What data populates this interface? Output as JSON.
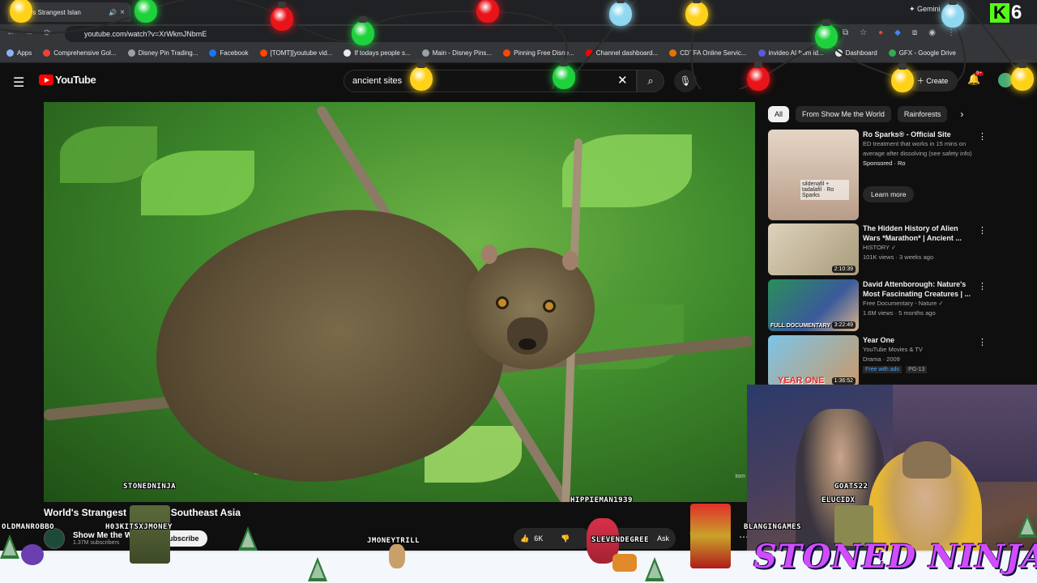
{
  "browser": {
    "tab_title": "World's Strangest Islan",
    "tab_close": "×",
    "gemini_label": "✦ Gemini",
    "url": "youtube.com/watch?v=XrWkmJNbmE",
    "nav_icons": [
      "←",
      "→",
      "⟳"
    ],
    "kick_badge": "K",
    "window_number": "6"
  },
  "bookmarks": [
    {
      "label": "Apps",
      "color": "#8ab4f8"
    },
    {
      "label": "Comprehensive Gol...",
      "color": "#ea4335"
    },
    {
      "label": "Disney Pin Trading...",
      "color": "#9aa0a6"
    },
    {
      "label": "Facebook",
      "color": "#1877f2"
    },
    {
      "label": "[TOMT][youtube vid...",
      "color": "#ff4500"
    },
    {
      "label": "If todays people s...",
      "color": "#e8eaed"
    },
    {
      "label": "Main - Disney Pins...",
      "color": "#9aa0a6"
    },
    {
      "label": "Pinning Free Disne...",
      "color": "#ff4500"
    },
    {
      "label": "Channel dashboard...",
      "color": "#ff0000"
    },
    {
      "label": "CDTFA Online Servic...",
      "color": "#e37400"
    },
    {
      "label": "invideo AI from id...",
      "color": "#5b5bd6"
    },
    {
      "label": "Dashboard",
      "color": "#e8eaed"
    },
    {
      "label": "GFX - Google Drive",
      "color": "#34a853"
    }
  ],
  "youtube": {
    "logo_text": "YouTube",
    "search_value": "ancient sites",
    "create_label": "Create",
    "notif_count": "9+"
  },
  "sidebar": {
    "chips": [
      "All",
      "From Show Me the World",
      "Rainforests"
    ],
    "recommendations": [
      {
        "title": "Ro Sparks® - Official Site",
        "line1": "ED treatment that works in 15 mins on average after dissolving (see safety info)",
        "line2": "Sponsored · Ro",
        "cta": "Learn more",
        "thumb_text": "sildenafil + tadalafil · Ro Sparks",
        "thumb_color": "#d9c9bd"
      },
      {
        "title": "The Hidden History of Alien Wars *Marathon* | Ancient ...",
        "line1": "HISTORY ✓",
        "line2": "101K views · 3 weeks ago",
        "duration": "2:10:39",
        "thumb_color": "#cfc5b0"
      },
      {
        "title": "David Attenborough: Nature's Most Fascinating Creatures | ...",
        "line1": "Free Documentary - Nature ✓",
        "line2": "1.6M views · 5 months ago",
        "duration": "3:22:49",
        "thumb_text": "FULL DOCUMENTARY",
        "thumb_color": "#3a6a8a"
      },
      {
        "title": "Year One",
        "line1": "YouTube Movies & TV",
        "line2": "Drama · 2009",
        "free_badge": "Free with ads",
        "rating": "PG-13",
        "duration": "1:36:52",
        "thumb_text": "YEAR ONE",
        "thumb_color": "#6ab0d8"
      }
    ]
  },
  "video": {
    "title": "World's Strangest Islands | Southeast Asia",
    "channel": "Show Me the World",
    "subscribers": "1.37M subscribers",
    "subscribe_label": "Subscribe",
    "likes": "6K",
    "ask_label": "Ask",
    "watermark": "lism"
  },
  "overlay": {
    "usernames": [
      "STONEDNINJA",
      "HIPPIEMAN1939",
      "OLDMANROBBO",
      "H03KITSXJMONEY",
      "JMONEYTRILL",
      "SLEVENDEGREE",
      "BLANGINGAMES",
      "GOATS22",
      "ELUCIDX"
    ],
    "banner": "STONED NINJA",
    "bulb_colors": [
      "#ffd21a",
      "#1fd13c",
      "#e8141a",
      "#1fd13c",
      "#ffd21a",
      "#e8141a",
      "#1fd13c",
      "#8fd8f0",
      "#ffd21a",
      "#e8141a",
      "#1fd13c",
      "#ffd21a",
      "#8fd8f0",
      "#ffd21a"
    ]
  }
}
